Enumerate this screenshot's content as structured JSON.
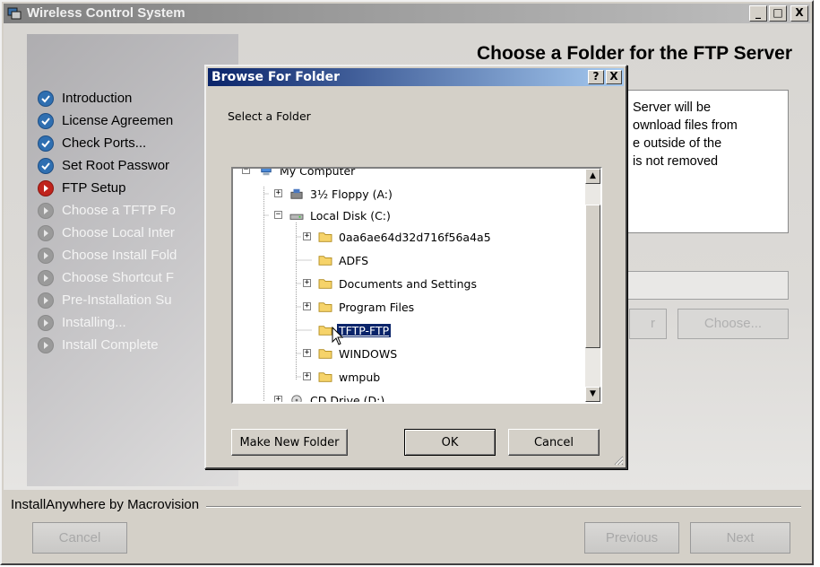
{
  "window": {
    "title": "Wireless Control System",
    "controls": {
      "minimize": "_",
      "maximize": "□",
      "close": "X"
    }
  },
  "installer": {
    "header_title": "Choose a Folder for the FTP Server",
    "steps": [
      {
        "label": "Introduction",
        "status": "done"
      },
      {
        "label": "License Agreemen",
        "status": "done"
      },
      {
        "label": "Check Ports...",
        "status": "done"
      },
      {
        "label": "Set Root Passwor",
        "status": "done"
      },
      {
        "label": "FTP Setup",
        "status": "current"
      },
      {
        "label": "Choose a TFTP Fo",
        "status": "pending"
      },
      {
        "label": "Choose Local Inter",
        "status": "pending"
      },
      {
        "label": "Choose Install Fold",
        "status": "pending"
      },
      {
        "label": "Choose Shortcut F",
        "status": "pending"
      },
      {
        "label": "Pre-Installation Su",
        "status": "pending"
      },
      {
        "label": "Installing...",
        "status": "pending"
      },
      {
        "label": "Install Complete",
        "status": "pending"
      }
    ],
    "description_lines": [
      "Server will be",
      "ownload files from",
      "e outside of the",
      "is not removed"
    ],
    "restore_button": "r",
    "choose_button": "Choose...",
    "footer_label": "InstallAnywhere by Macrovision",
    "cancel_button": "Cancel",
    "previous_button": "Previous",
    "next_button": "Next"
  },
  "dialog": {
    "title": "Browse For Folder",
    "help_button": "?",
    "close_button": "X",
    "prompt": "Select a Folder",
    "tree": [
      {
        "label": "My Computer",
        "expander": "−",
        "icon": "computer-icon"
      },
      {
        "label": "3½ Floppy (A:)",
        "expander": "+",
        "icon": "floppy-icon"
      },
      {
        "label": "Local Disk (C:)",
        "expander": "−",
        "icon": "disk-icon"
      },
      {
        "label": "0aa6ae64d32d716f56a4a5",
        "expander": "+",
        "icon": "folder-icon"
      },
      {
        "label": "ADFS",
        "expander": "",
        "icon": "folder-icon"
      },
      {
        "label": "Documents and Settings",
        "expander": "+",
        "icon": "folder-icon"
      },
      {
        "label": "Program Files",
        "expander": "+",
        "icon": "folder-icon"
      },
      {
        "label": "TFTP-FTP",
        "expander": "",
        "icon": "folder-icon",
        "selected": true
      },
      {
        "label": "WINDOWS",
        "expander": "+",
        "icon": "folder-icon"
      },
      {
        "label": "wmpub",
        "expander": "+",
        "icon": "folder-icon"
      },
      {
        "label": "CD Drive (D:)",
        "expander": "+",
        "icon": "cd-drive-icon"
      }
    ],
    "make_new_folder_button": "Make New Folder",
    "ok_button": "OK",
    "cancel_button": "Cancel"
  },
  "colors": {
    "dialog_title_start": "#0a246a",
    "dialog_title_end": "#a6caf0",
    "step_done": "#2f6fb1",
    "step_current": "#c0241c",
    "step_pending": "#9a9a9a"
  }
}
